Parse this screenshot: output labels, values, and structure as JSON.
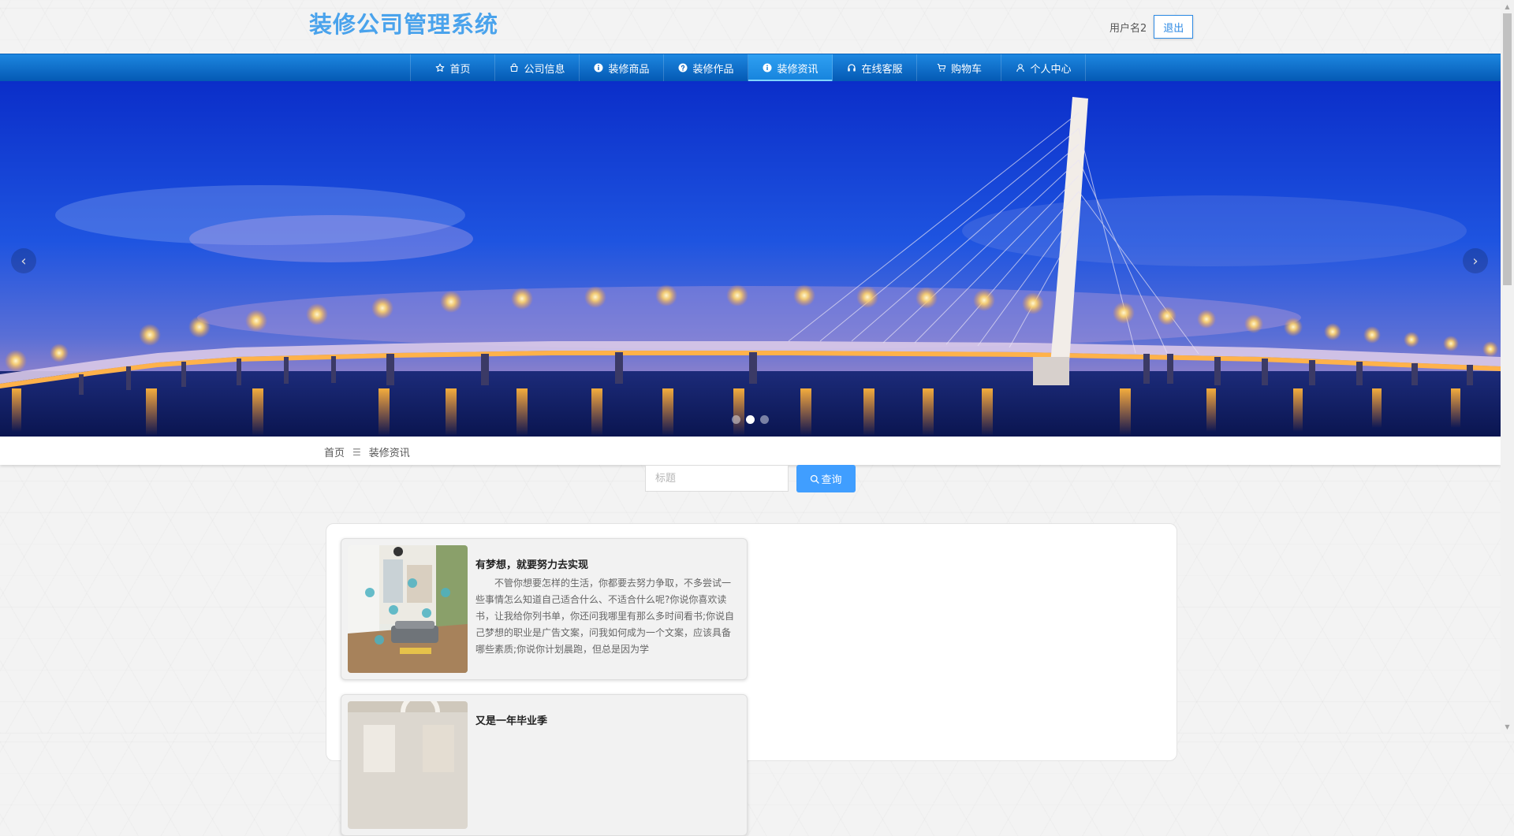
{
  "header": {
    "title": "装修公司管理系统",
    "username": "用户名2",
    "logout_label": "退出"
  },
  "nav": {
    "items": [
      {
        "label": "首页",
        "icon": "star-icon"
      },
      {
        "label": "公司信息",
        "icon": "bag-icon"
      },
      {
        "label": "装修商品",
        "icon": "info-circle-icon"
      },
      {
        "label": "装修作品",
        "icon": "question-circle-icon"
      },
      {
        "label": "装修资讯",
        "icon": "info-circle-icon",
        "active": true
      },
      {
        "label": "在线客服",
        "icon": "headset-icon"
      },
      {
        "label": "购物车",
        "icon": "cart-icon"
      },
      {
        "label": "个人中心",
        "icon": "user-icon"
      }
    ]
  },
  "carousel": {
    "prev_label": "‹",
    "next_label": "›",
    "slide_count": 3,
    "active_slide": 2
  },
  "breadcrumb": {
    "home": "首页",
    "separator": "☰",
    "current": "装修资讯"
  },
  "search": {
    "placeholder": "标题",
    "value": "",
    "button_label": "查询"
  },
  "news": {
    "items": [
      {
        "title": "有梦想，就要努力去实现",
        "summary": "不管你想要怎样的生活，你都要去努力争取，不多尝试一些事情怎么知道自己适合什么、不适合什么呢?你说你喜欢读书，让我给你列书单，你还问我哪里有那么多时间看书;你说自己梦想的职业是广告文案，问我如何成为一个文案，应该具备哪些素质;你说你计划晨跑，但总是因为学"
      },
      {
        "title": "又是一年毕业季",
        "summary": ""
      }
    ]
  },
  "colors": {
    "brand": "#4aa3ec",
    "nav_bg": "#0868c4",
    "nav_active": "#1f8ee6",
    "search_button": "#409eff"
  }
}
